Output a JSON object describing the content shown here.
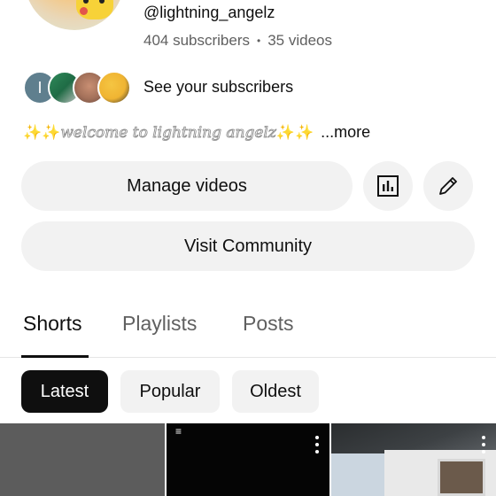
{
  "channel": {
    "handle": "@lightning_angelz",
    "subscribers": "404 subscribers",
    "separator": "•",
    "videos": "35 videos",
    "see_subscribers": "See your subscribers",
    "subscriber_avatars": [
      {
        "initial": "I",
        "color": "#5f7f8e"
      },
      {
        "initial": "",
        "color": "#2f8a5a"
      },
      {
        "initial": "",
        "color": "#a4715a"
      },
      {
        "initial": "",
        "color": "#f0b432"
      }
    ]
  },
  "bio": {
    "sparkles_left": "✨✨",
    "text": "welcome to lightning angelz",
    "sparkles_right": "✨✨",
    "more": "...more"
  },
  "buttons": {
    "manage_videos": "Manage videos",
    "analytics_icon": "analytics-icon",
    "edit_icon": "pencil-icon",
    "visit_community": "Visit Community"
  },
  "tabs": [
    {
      "label": "Shorts",
      "active": true
    },
    {
      "label": "Playlists",
      "active": false
    },
    {
      "label": "Posts",
      "active": false
    }
  ],
  "filters": [
    {
      "label": "Latest",
      "selected": true
    },
    {
      "label": "Popular",
      "selected": false
    },
    {
      "label": "Oldest",
      "selected": false
    }
  ],
  "thumbnails": [
    {
      "name": "short-1",
      "color": "#5c5c5c"
    },
    {
      "name": "short-2",
      "color": "#050505"
    },
    {
      "name": "short-3",
      "color": "#c9ccd0"
    }
  ],
  "colors": {
    "text_primary": "#0f0f0f",
    "text_secondary": "#606060",
    "chip_bg": "#f2f2f2",
    "chip_selected_bg": "#0f0f0f"
  }
}
